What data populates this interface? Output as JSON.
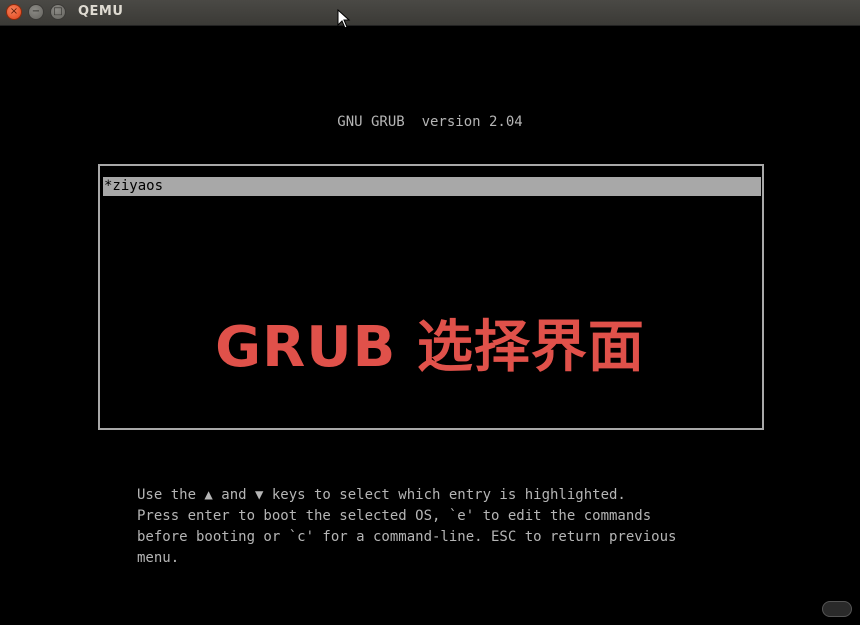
{
  "window": {
    "title": "QEMU",
    "controls": {
      "close_icon": "close-icon",
      "minimize_icon": "minimize-icon",
      "maximize_icon": "maximize-icon",
      "close_glyph": "×",
      "minimize_glyph": "−",
      "maximize_glyph": "□"
    }
  },
  "grub": {
    "header": "GNU GRUB  version 2.04",
    "menu": {
      "entries": [
        {
          "label": "*ziyaos",
          "selected": true
        }
      ]
    },
    "help_lines": [
      "Use the ▲ and ▼ keys to select which entry is highlighted.",
      "Press enter to boot the selected OS, `e' to edit the commands",
      "before booting or `c' for a command-line. ESC to return previous",
      "menu."
    ]
  },
  "overlay": {
    "label": "GRUB 选择界面"
  },
  "colors": {
    "background": "#000000",
    "grub_text": "#b5b5b5",
    "highlight": "#a8a8a8",
    "overlay_text": "#e0514a",
    "close_button": "#e0421a"
  }
}
